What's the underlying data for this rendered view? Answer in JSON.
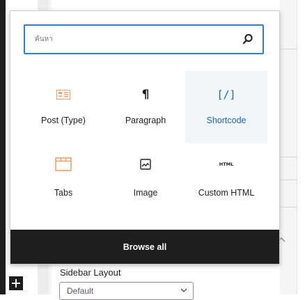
{
  "search": {
    "placeholder": "ค้นหา",
    "value": ""
  },
  "blocks": [
    {
      "label": "Post (Type)",
      "icon": "post-type-icon",
      "selected": false
    },
    {
      "label": "Paragraph",
      "icon": "paragraph-icon",
      "selected": false
    },
    {
      "label": "Shortcode",
      "icon": "shortcode-icon",
      "selected": true
    },
    {
      "label": "Tabs",
      "icon": "tabs-icon",
      "selected": false
    },
    {
      "label": "Image",
      "icon": "image-icon",
      "selected": false
    },
    {
      "label": "Custom HTML",
      "icon": "html-icon",
      "selected": false
    }
  ],
  "icons": {
    "paragraph_glyph": "¶",
    "shortcode_glyph": "[/]",
    "html_glyph": "HTML"
  },
  "browse_all_label": "Browse all",
  "sidebar": {
    "label": "Sidebar Layout",
    "select_value": "Default"
  },
  "colors": {
    "accent": "#3c7ac0",
    "orange": "#f0a06a",
    "dark": "#1e1e1e",
    "selected_bg": "#f0f5fa"
  }
}
